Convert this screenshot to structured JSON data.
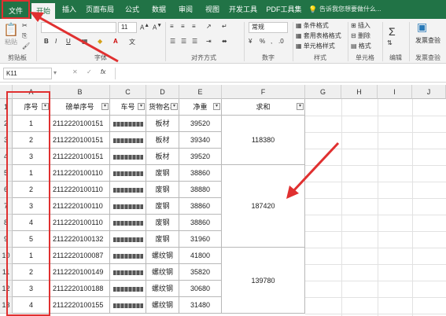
{
  "ribbon_tabs": [
    "文件",
    "开始",
    "插入",
    "页面布局",
    "公式",
    "数据",
    "审阅",
    "视图",
    "开发工具",
    "PDF工具集"
  ],
  "tell_me": "告诉我您想要做什么...",
  "groups": {
    "clipboard": {
      "label": "剪贴板",
      "paste": "粘贴"
    },
    "font": {
      "label": "字体",
      "size": "11",
      "bold": "B",
      "italic": "I",
      "underline": "U"
    },
    "alignment": {
      "label": "对齐方式"
    },
    "number": {
      "label": "数字",
      "format": "常规",
      "percent": "%"
    },
    "styles": {
      "label": "样式",
      "items": [
        "条件格式",
        "套用表格格式",
        "单元格样式"
      ]
    },
    "cells": {
      "label": "单元格",
      "items": [
        "插入",
        "删除",
        "格式"
      ]
    },
    "editing": {
      "label": "编辑"
    },
    "invoice": {
      "label": "发票查验",
      "button": "发票查验"
    }
  },
  "formula_bar": {
    "name_box": "K11",
    "fx": "fx",
    "value": ""
  },
  "columns": [
    "A",
    "B",
    "C",
    "D",
    "E",
    "F",
    "G",
    "H",
    "I",
    "J"
  ],
  "row_numbers": [
    "1",
    "2",
    "3",
    "4",
    "5",
    "6",
    "7",
    "8",
    "9",
    "10",
    "11",
    "12",
    "13"
  ],
  "headers": [
    "序号",
    "磅单序号",
    "车号",
    "货物名称",
    "净重",
    "求和"
  ],
  "rows": [
    {
      "seq": "1",
      "slip": "2112220100151",
      "cargo": "板材",
      "weight": "39520"
    },
    {
      "seq": "2",
      "slip": "2112220100151",
      "cargo": "板材",
      "weight": "39340"
    },
    {
      "seq": "3",
      "slip": "2112220100151",
      "cargo": "板材",
      "weight": "39520"
    },
    {
      "seq": "1",
      "slip": "2112220100110",
      "cargo": "废钢",
      "weight": "38860"
    },
    {
      "seq": "2",
      "slip": "2112220100110",
      "cargo": "废钢",
      "weight": "38880"
    },
    {
      "seq": "3",
      "slip": "2112220100110",
      "cargo": "废钢",
      "weight": "38860"
    },
    {
      "seq": "4",
      "slip": "2112220100110",
      "cargo": "废钢",
      "weight": "38860"
    },
    {
      "seq": "5",
      "slip": "2112220100132",
      "cargo": "废钢",
      "weight": "31960"
    },
    {
      "seq": "1",
      "slip": "2112220100087",
      "cargo": "螺纹钢",
      "weight": "41800"
    },
    {
      "seq": "2",
      "slip": "2112220100149",
      "cargo": "螺纹钢",
      "weight": "35820"
    },
    {
      "seq": "3",
      "slip": "2112220100188",
      "cargo": "螺纹钢",
      "weight": "30680"
    },
    {
      "seq": "4",
      "slip": "2112220100155",
      "cargo": "螺纹钢",
      "weight": "31480"
    }
  ],
  "sums": [
    "118380",
    "187420",
    "139780"
  ]
}
